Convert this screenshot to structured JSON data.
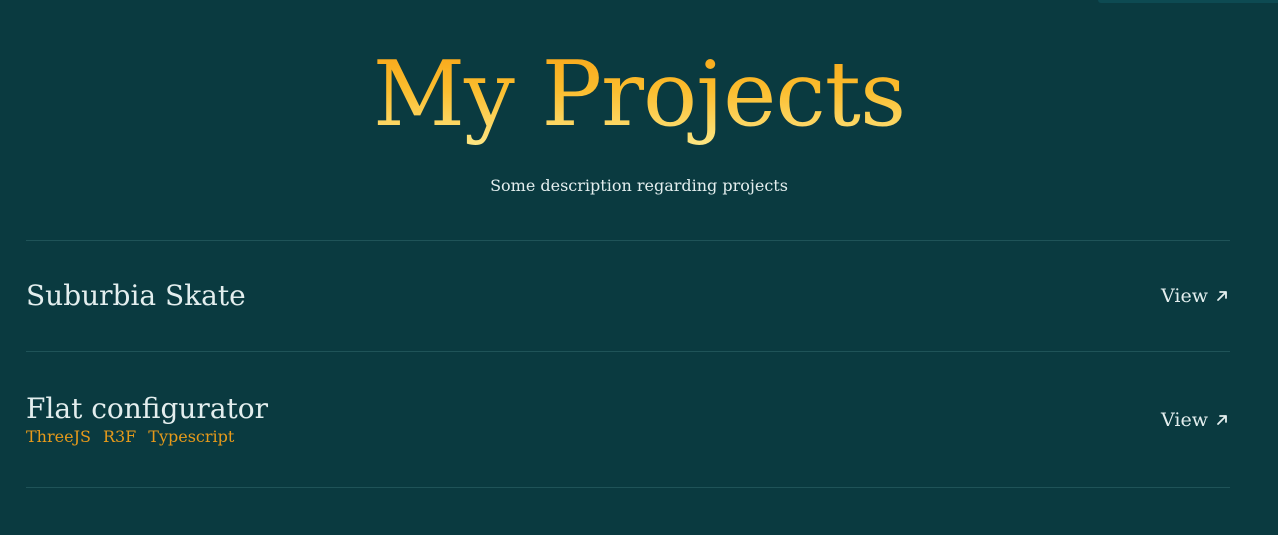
{
  "hero": {
    "title": "My Projects",
    "description": "Some description regarding projects"
  },
  "projects": [
    {
      "name": "Suburbia Skate",
      "tags": [],
      "link_label": "View",
      "icon": "arrow-up-right-icon"
    },
    {
      "name": "Flat configurator",
      "tags": [
        "ThreeJS",
        "R3F",
        "Typescript"
      ],
      "link_label": "View",
      "icon": "arrow-up-right-icon"
    }
  ],
  "colors": {
    "background": "#0a3a40",
    "title_gradient_top": "#f7a014",
    "title_gradient_bottom": "#fde98a",
    "tag": "#e79a1a",
    "divider": "#1f5358",
    "text": "#e3eeee"
  }
}
